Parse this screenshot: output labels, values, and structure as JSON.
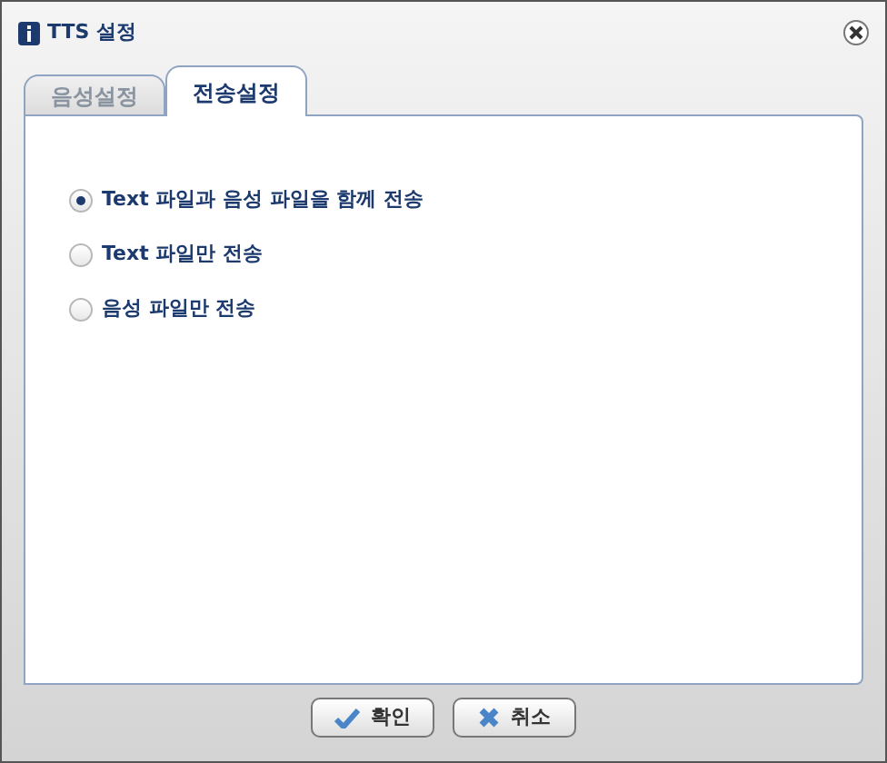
{
  "window": {
    "title": "TTS 설정"
  },
  "tabs": [
    {
      "label": "음성설정",
      "selected": false
    },
    {
      "label": "전송설정",
      "selected": true
    }
  ],
  "options": [
    {
      "label": "Text 파일과 음성 파일을 함께 전송",
      "selected": true
    },
    {
      "label": "Text 파일만 전송",
      "selected": false
    },
    {
      "label": "음성 파일만 전송",
      "selected": false
    }
  ],
  "buttons": [
    {
      "label": "확인",
      "kind": "ok"
    },
    {
      "label": "취소",
      "kind": "cancel"
    }
  ]
}
